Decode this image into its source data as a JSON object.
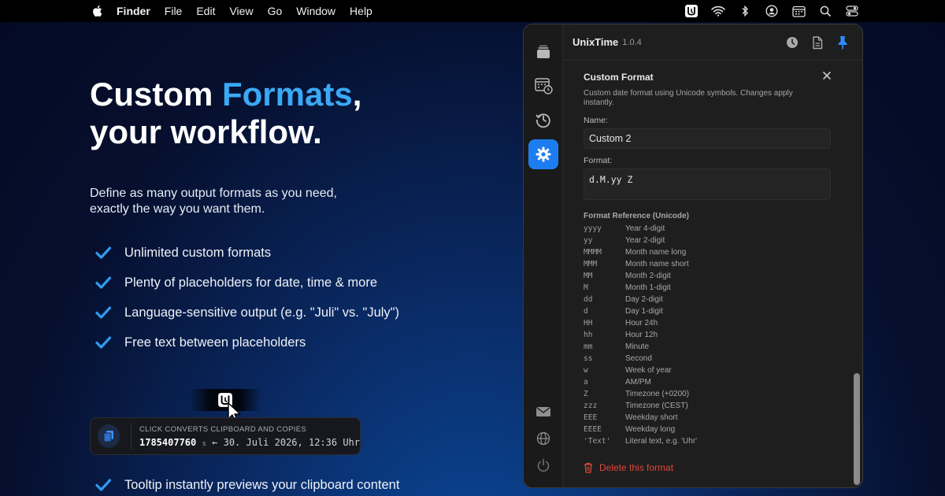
{
  "menubar": {
    "app_name": "Finder",
    "menus": [
      "File",
      "Edit",
      "View",
      "Go",
      "Window",
      "Help"
    ],
    "status_icons": [
      "unixtime-menu-icon",
      "wifi-icon",
      "bluetooth-icon",
      "user-icon",
      "calendar-icon",
      "search-icon",
      "control-center-icon"
    ]
  },
  "hero": {
    "headline_part1": "Custom ",
    "headline_accent": "Formats",
    "headline_part2": ",",
    "headline_line2": "your workflow.",
    "subtitle": "Define as many output formats as you need, exactly the way you want them.",
    "accent_color": "#3aa9f5"
  },
  "features": [
    "Unlimited custom formats",
    "Plenty of placeholders for date, time & more",
    "Language-sensitive output (e.g. \"Juli\" vs. \"July\")",
    "Free text between placeholders"
  ],
  "bottom_feature": "Tooltip instantly previews your clipboard content",
  "tooltip": {
    "label": "CLICK CONVERTS CLIPBOARD AND COPIES",
    "timestamp": "1785407760",
    "unit": "s",
    "arrow": "←",
    "converted": "30. Juli 2026, 12:36 Uhr"
  },
  "app": {
    "title": "UnixTime",
    "version": "1.0.4",
    "sidebar_items": [
      "stack-icon",
      "calendar-clock-icon",
      "history-icon",
      "settings-icon"
    ],
    "sidebar_bottom": [
      "mail-icon",
      "globe-icon",
      "power-icon"
    ],
    "header_icons": [
      "clock-icon",
      "document-icon",
      "pin-icon"
    ],
    "panel": {
      "title": "Custom Format",
      "description": "Custom date format using Unicode symbols. Changes apply instantly.",
      "name_label": "Name:",
      "name_value": "Custom 2",
      "format_label": "Format:",
      "format_value": "d.M.yy Z",
      "reference_title": "Format Reference (Unicode)",
      "reference": [
        {
          "token": "yyyy",
          "desc": "Year 4-digit"
        },
        {
          "token": "yy",
          "desc": "Year 2-digit"
        },
        {
          "token": "MMMM",
          "desc": "Month name long"
        },
        {
          "token": "MMM",
          "desc": "Month name short"
        },
        {
          "token": "MM",
          "desc": "Month 2-digit"
        },
        {
          "token": "M",
          "desc": "Month 1-digit"
        },
        {
          "token": "dd",
          "desc": "Day 2-digit"
        },
        {
          "token": "d",
          "desc": "Day 1-digit"
        },
        {
          "token": "HH",
          "desc": "Hour 24h"
        },
        {
          "token": "hh",
          "desc": "Hour 12h"
        },
        {
          "token": "mm",
          "desc": "Minute"
        },
        {
          "token": "ss",
          "desc": "Second"
        },
        {
          "token": "w",
          "desc": "Week of year"
        },
        {
          "token": "a",
          "desc": "AM/PM"
        },
        {
          "token": "Z",
          "desc": "Timezone (+0200)"
        },
        {
          "token": "zzz",
          "desc": "Timezone (CEST)"
        },
        {
          "token": "EEE",
          "desc": "Weekday short"
        },
        {
          "token": "EEEE",
          "desc": "Weekday long"
        },
        {
          "token": "'Text'",
          "desc": "Literal text, e.g. 'Uhr'"
        }
      ],
      "delete_label": "Delete this format"
    }
  }
}
